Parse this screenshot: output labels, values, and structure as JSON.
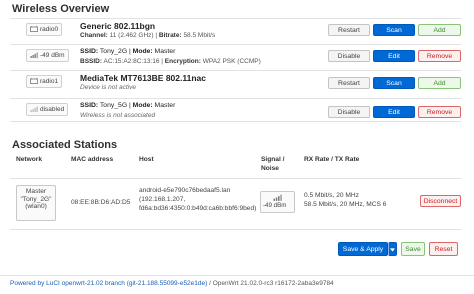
{
  "wireless_overview": {
    "heading": "Wireless Overview",
    "rows": [
      {
        "tag": "radio0",
        "title": "Generic 802.11bgn",
        "line2": [
          {
            "key": "Channel:",
            "val": " 11 (2.462 GHz) | "
          },
          {
            "key": "Bitrate:",
            "val": " 58.5 Mbit/s"
          }
        ],
        "buttons": [
          "Restart",
          "Scan",
          "Add"
        ]
      },
      {
        "tag": "-49 dBm",
        "title_parts": [
          {
            "key": "SSID:",
            "val": " Tony_2G | "
          },
          {
            "key": "Mode:",
            "val": " Master"
          }
        ],
        "line2": [
          {
            "key": "BSSID:",
            "val": " AC:15:A2:8C:13:16 | "
          },
          {
            "key": "Encryption:",
            "val": " WPA2 PSK (CCMP)"
          }
        ],
        "buttons": [
          "Disable",
          "Edit",
          "Remove"
        ]
      },
      {
        "tag": "radio1",
        "title": "MediaTek MT7613BE 802.11nac",
        "note": "Device is not active",
        "buttons": [
          "Restart",
          "Scan",
          "Add"
        ]
      },
      {
        "tag": "disabled",
        "title_parts": [
          {
            "key": "SSID:",
            "val": " Tony_5G | "
          },
          {
            "key": "Mode:",
            "val": " Master"
          }
        ],
        "note": "Wireless is not associated",
        "buttons": [
          "Disable",
          "Edit",
          "Remove"
        ]
      }
    ]
  },
  "associated_stations": {
    "heading": "Associated Stations",
    "columns": [
      "Network",
      "MAC address",
      "Host",
      "Signal / Noise",
      "RX Rate / TX Rate"
    ],
    "station": {
      "network": [
        "Master",
        "\"Tony_2G\"",
        "(wlan0)"
      ],
      "mac": "08:EE:8B:D6:AD:D5",
      "host": [
        "android-e5e790c76bedaaf5.lan",
        "(192.168.1.207,",
        "fd6a:bd36:4350:0:b49d:ca6b:bbf6:9bed)"
      ],
      "signal": "-49 dBm",
      "rates": [
        "0.5 Mbit/s, 20 MHz",
        "58.5 Mbit/s, 20 MHz, MCS 6"
      ],
      "action": "Disconnect"
    }
  },
  "actions": {
    "save_apply": "Save & Apply",
    "save": "Save",
    "reset": "Reset"
  },
  "footer": {
    "powered": "Powered by LuCI openwrt-21.02 branch (git-21.188.55099-e52e1de)",
    "separator": " / ",
    "version": "OpenWrt 21.02.0-rc3 r16172-2aba3e9784"
  },
  "colors": {
    "primary": "#0069d6",
    "add_green": "#3d8b2f",
    "remove_red": "#cc2222"
  }
}
